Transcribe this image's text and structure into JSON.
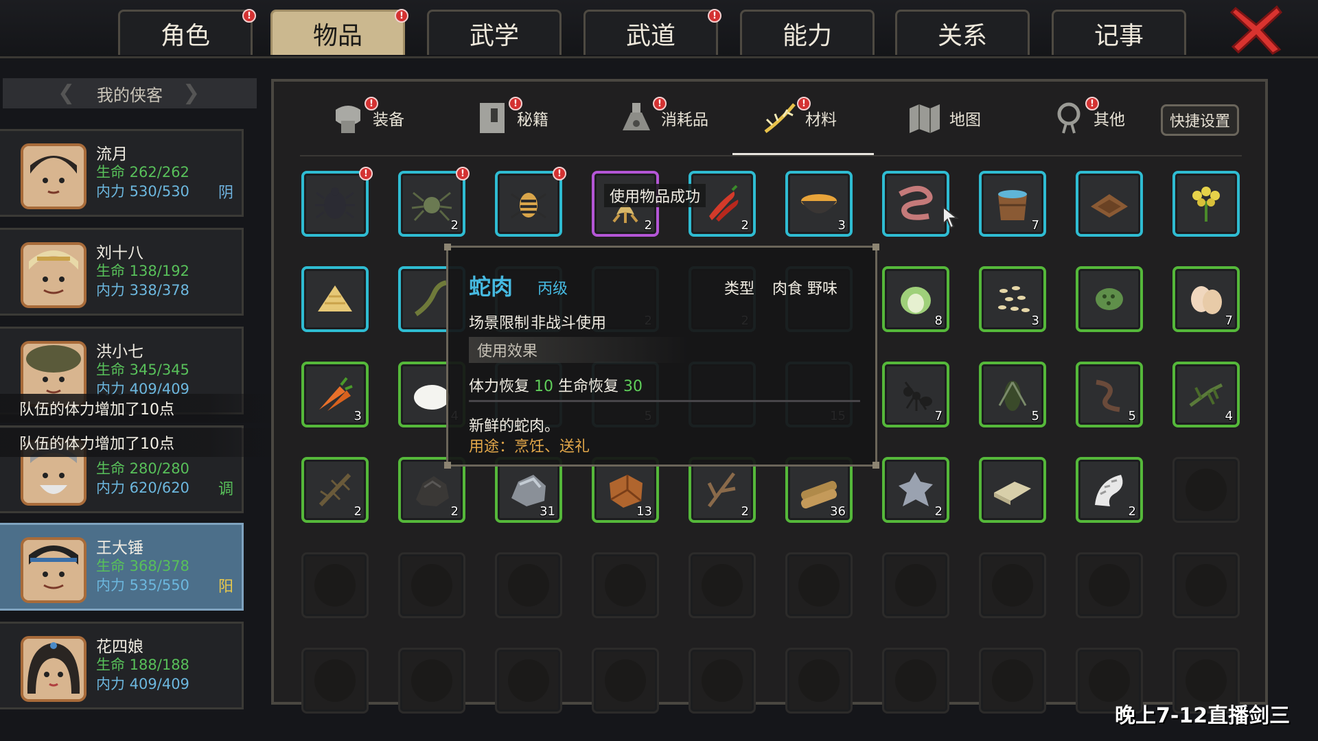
{
  "top_tabs": [
    {
      "label": "角色",
      "badge": "!",
      "active": false
    },
    {
      "label": "物品",
      "badge": "!",
      "active": true
    },
    {
      "label": "武学",
      "badge": "",
      "active": false
    },
    {
      "label": "武道",
      "badge": "!",
      "active": false
    },
    {
      "label": "能力",
      "badge": "",
      "active": false
    },
    {
      "label": "关系",
      "badge": "",
      "active": false
    },
    {
      "label": "记事",
      "badge": "",
      "active": false
    }
  ],
  "close_icon": "close-x-icon",
  "roster": {
    "header": "我的侠客",
    "characters": [
      {
        "name": "流月",
        "hp": "生命 262/262",
        "mp": "内力 530/530",
        "tag": "阴",
        "tag_color": "#6fb3e0"
      },
      {
        "name": "刘十八",
        "hp": "生命 138/192",
        "mp": "内力 338/378",
        "tag": "",
        "tag_color": ""
      },
      {
        "name": "洪小七",
        "hp": "生命 345/345",
        "mp": "内力 409/409",
        "tag": "",
        "tag_color": ""
      },
      {
        "name": "",
        "hp": "生命 280/280",
        "mp": "内力 620/620",
        "tag": "调",
        "tag_color": "#58c05a"
      },
      {
        "name": "王大锤",
        "hp": "生命 368/378",
        "mp": "内力 535/550",
        "tag": "阳",
        "tag_color": "#e9c94c"
      },
      {
        "name": "花四娘",
        "hp": "生命 188/188",
        "mp": "内力 409/409",
        "tag": "",
        "tag_color": ""
      }
    ],
    "toasts": [
      "队伍的体力增加了10点",
      "队伍的体力增加了10点"
    ]
  },
  "sub_tabs": [
    {
      "label": "装备",
      "icon": "equipment-icon",
      "badge": "!"
    },
    {
      "label": "秘籍",
      "icon": "manual-book-icon",
      "badge": "!"
    },
    {
      "label": "消耗品",
      "icon": "potion-icon",
      "badge": "!"
    },
    {
      "label": "材料",
      "icon": "herb-material-icon",
      "badge": "!"
    },
    {
      "label": "地图",
      "icon": "map-icon",
      "badge": ""
    },
    {
      "label": "其他",
      "icon": "misc-icon",
      "badge": "!"
    }
  ],
  "quick_settings": "快捷设置",
  "success_message": "使用物品成功",
  "inventory": [
    [
      {
        "icon": "black-beetle-icon",
        "count": "",
        "rarity": "blue",
        "badge": "!"
      },
      {
        "icon": "green-spider-icon",
        "count": "2",
        "rarity": "blue",
        "badge": "!"
      },
      {
        "icon": "striped-bug-icon",
        "count": "",
        "rarity": "blue",
        "badge": "!"
      },
      {
        "icon": "ginseng-root-icon",
        "count": "2",
        "rarity": "purple",
        "badge": ""
      },
      {
        "icon": "red-chili-icon",
        "count": "2",
        "rarity": "blue",
        "badge": ""
      },
      {
        "icon": "bowl-soup-icon",
        "count": "3",
        "rarity": "blue",
        "badge": ""
      },
      {
        "icon": "snake-meat-icon",
        "count": "",
        "rarity": "blue",
        "badge": ""
      },
      {
        "icon": "water-bucket-icon",
        "count": "7",
        "rarity": "blue",
        "badge": ""
      },
      {
        "icon": "brown-pastry-icon",
        "count": "",
        "rarity": "blue",
        "badge": ""
      },
      {
        "icon": "yellow-flower-icon",
        "count": "",
        "rarity": "blue",
        "badge": ""
      }
    ],
    [
      {
        "icon": "grain-pile-icon",
        "count": "",
        "rarity": "blue",
        "badge": ""
      },
      {
        "icon": "lizard-icon",
        "count": "",
        "rarity": "blue",
        "badge": ""
      },
      {
        "icon": "hidden-icon",
        "count": "3",
        "rarity": "hidden",
        "badge": ""
      },
      {
        "icon": "hidden-icon",
        "count": "2",
        "rarity": "hidden",
        "badge": ""
      },
      {
        "icon": "hidden-icon",
        "count": "2",
        "rarity": "hidden",
        "badge": ""
      },
      {
        "icon": "hidden-icon",
        "count": "",
        "rarity": "hidden",
        "badge": ""
      },
      {
        "icon": "cabbage-icon",
        "count": "8",
        "rarity": "green",
        "badge": ""
      },
      {
        "icon": "seeds-icon",
        "count": "3",
        "rarity": "green",
        "badge": ""
      },
      {
        "icon": "lotus-seedpod-icon",
        "count": "",
        "rarity": "green",
        "badge": ""
      },
      {
        "icon": "eggs-icon",
        "count": "7",
        "rarity": "green",
        "badge": ""
      }
    ],
    [
      {
        "icon": "carrot-icon",
        "count": "3",
        "rarity": "green",
        "badge": ""
      },
      {
        "icon": "rice-icon",
        "count": "4",
        "rarity": "green",
        "badge": ""
      },
      {
        "icon": "hidden-icon",
        "count": "",
        "rarity": "hidden",
        "badge": ""
      },
      {
        "icon": "hidden-icon",
        "count": "5",
        "rarity": "hidden",
        "badge": ""
      },
      {
        "icon": "hidden-icon",
        "count": "",
        "rarity": "hidden",
        "badge": ""
      },
      {
        "icon": "hidden-icon",
        "count": "15",
        "rarity": "hidden",
        "badge": ""
      },
      {
        "icon": "black-ant-icon",
        "count": "7",
        "rarity": "green",
        "badge": ""
      },
      {
        "icon": "cicada-icon",
        "count": "5",
        "rarity": "green",
        "badge": ""
      },
      {
        "icon": "centipede-icon",
        "count": "5",
        "rarity": "green",
        "badge": ""
      },
      {
        "icon": "mantis-icon",
        "count": "4",
        "rarity": "green",
        "badge": ""
      }
    ],
    [
      {
        "icon": "stick-insect-icon",
        "count": "2",
        "rarity": "green",
        "badge": ""
      },
      {
        "icon": "coal-icon",
        "count": "2",
        "rarity": "green",
        "badge": ""
      },
      {
        "icon": "iron-ore-icon",
        "count": "31",
        "rarity": "green",
        "badge": ""
      },
      {
        "icon": "copper-ore-icon",
        "count": "13",
        "rarity": "green",
        "badge": ""
      },
      {
        "icon": "branch-icon",
        "count": "2",
        "rarity": "green",
        "badge": ""
      },
      {
        "icon": "logs-icon",
        "count": "36",
        "rarity": "green",
        "badge": ""
      },
      {
        "icon": "wolf-pelt-icon",
        "count": "2",
        "rarity": "green",
        "badge": ""
      },
      {
        "icon": "cloth-roll-icon",
        "count": "",
        "rarity": "green",
        "badge": ""
      },
      {
        "icon": "white-fur-icon",
        "count": "2",
        "rarity": "green",
        "badge": ""
      },
      {
        "icon": "",
        "count": "",
        "rarity": "empty",
        "badge": ""
      }
    ]
  ],
  "tooltip": {
    "name": "蛇肉",
    "grade": "丙级",
    "type_label": "类型",
    "type_value": "肉食 野味",
    "scene_label": "场景限制",
    "scene_value": "非战斗使用",
    "effect_header": "使用效果",
    "effect_stamina_label": "体力恢复",
    "effect_stamina_value": "10",
    "effect_hp_label": "生命恢复",
    "effect_hp_value": "30",
    "description": "新鲜的蛇肉。",
    "usage": "用途：烹饪、送礼"
  },
  "stream_note": "晚上7-12直播剑三",
  "colors": {
    "rarity_blue": "#2fbcd2",
    "rarity_purple": "#b456d6",
    "rarity_green": "#55b83a",
    "accent_gold": "#cbb88f"
  }
}
